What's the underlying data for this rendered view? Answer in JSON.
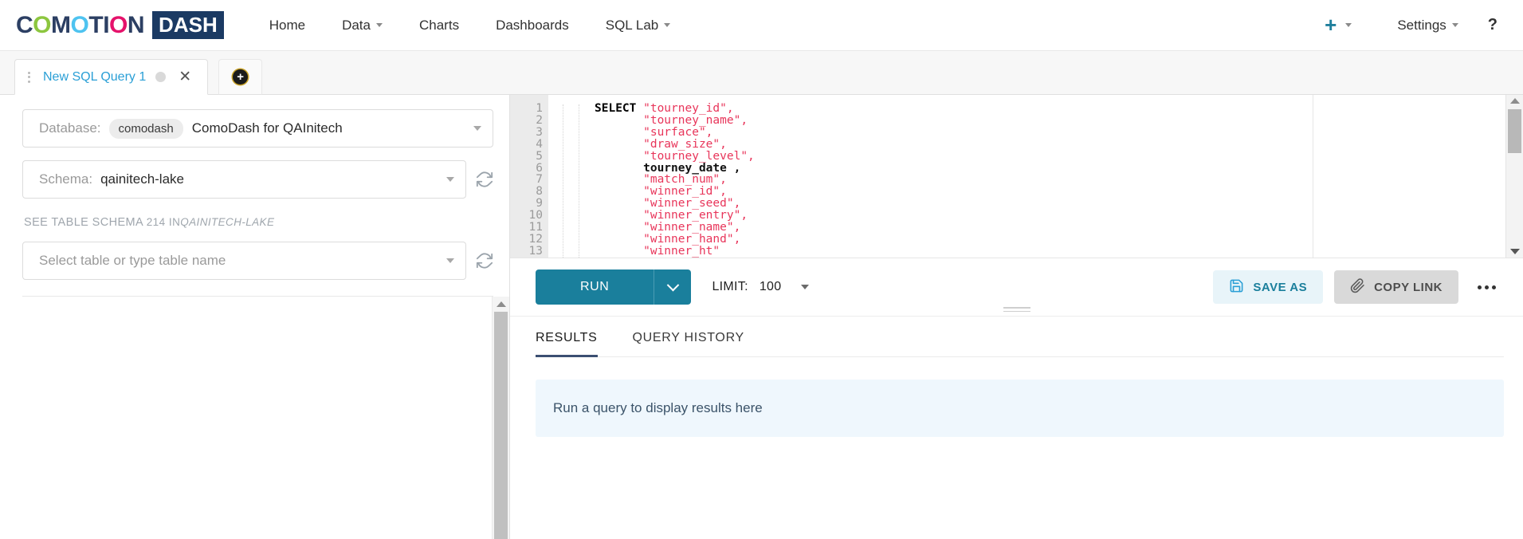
{
  "brand": {
    "word_letters": [
      {
        "ch": "C",
        "color": "#2c3f63"
      },
      {
        "ch": "O",
        "color": "#8cc63f"
      },
      {
        "ch": "M",
        "color": "#2c3f63"
      },
      {
        "ch": "O",
        "color": "#4ec3f0"
      },
      {
        "ch": "T",
        "color": "#2c3f63"
      },
      {
        "ch": "I",
        "color": "#2c3f63"
      },
      {
        "ch": "O",
        "color": "#e5126b"
      },
      {
        "ch": "N",
        "color": "#2c3f63"
      }
    ],
    "dash_label": "DASH",
    "dash_bg": "#1b3a63"
  },
  "nav": {
    "items": [
      {
        "label": "Home",
        "has_caret": false
      },
      {
        "label": "Data",
        "has_caret": true
      },
      {
        "label": "Charts",
        "has_caret": false
      },
      {
        "label": "Dashboards",
        "has_caret": false
      },
      {
        "label": "SQL Lab",
        "has_caret": true
      }
    ],
    "plus_label": "+",
    "settings_label": "Settings",
    "help_label": "?",
    "accent": "#1f7f9c"
  },
  "tabs": {
    "items": [
      {
        "label": "New SQL Query 1",
        "close_label": "✕"
      }
    ],
    "add_label": "+"
  },
  "left_panel": {
    "database": {
      "label": "Database:",
      "badge": "comodash",
      "value": "ComoDash for QAInitech"
    },
    "schema": {
      "label": "Schema:",
      "value": "qainitech-lake"
    },
    "table_schema_note": {
      "prefix": "SEE TABLE SCHEMA",
      "count": "214",
      "in_word": "IN",
      "schema_name": "QAINITECH-LAKE"
    },
    "table_select": {
      "placeholder": "Select table or type table name"
    }
  },
  "editor": {
    "line_numbers": [
      "1",
      "2",
      "3",
      "4",
      "5",
      "6",
      "7",
      "8",
      "9",
      "10",
      "11",
      "12",
      "13"
    ],
    "lines": [
      {
        "keyword": "SELECT ",
        "content": "\"tourney_id\",",
        "quoted": true
      },
      {
        "keyword": "",
        "content": "\"tourney_name\",",
        "quoted": true
      },
      {
        "keyword": "",
        "content": "\"surface\",",
        "quoted": true
      },
      {
        "keyword": "",
        "content": "\"draw_size\",",
        "quoted": true
      },
      {
        "keyword": "",
        "content": "\"tourney_level\",",
        "quoted": true
      },
      {
        "keyword": "",
        "content": "tourney_date ,",
        "quoted": false
      },
      {
        "keyword": "",
        "content": "\"match_num\",",
        "quoted": true
      },
      {
        "keyword": "",
        "content": "\"winner_id\",",
        "quoted": true
      },
      {
        "keyword": "",
        "content": "\"winner_seed\",",
        "quoted": true
      },
      {
        "keyword": "",
        "content": "\"winner_entry\",",
        "quoted": true
      },
      {
        "keyword": "",
        "content": "\"winner_name\",",
        "quoted": true
      },
      {
        "keyword": "",
        "content": "\"winner_hand\",",
        "quoted": true
      },
      {
        "keyword": "",
        "content": "\"winner_ht\"",
        "quoted": true
      }
    ],
    "raw_text": "SELECT \"tourney_id\",\n       \"tourney_name\",\n       \"surface\",\n       \"draw_size\",\n       \"tourney_level\",\n       tourney_date ,\n       \"match_num\",\n       \"winner_id\",\n       \"winner_seed\",\n       \"winner_entry\",\n       \"winner_name\",\n       \"winner_hand\",\n       \"winner_ht\""
  },
  "toolbar": {
    "run_label": "RUN",
    "limit_label": "LIMIT:",
    "limit_value": "100",
    "save_as_label": "SAVE AS",
    "copy_link_label": "COPY LINK",
    "run_color": "#1a7f9c"
  },
  "results": {
    "tabs": [
      {
        "label": "RESULTS",
        "active": true
      },
      {
        "label": "QUERY HISTORY",
        "active": false
      }
    ],
    "empty_message": "Run a query to display results here"
  }
}
